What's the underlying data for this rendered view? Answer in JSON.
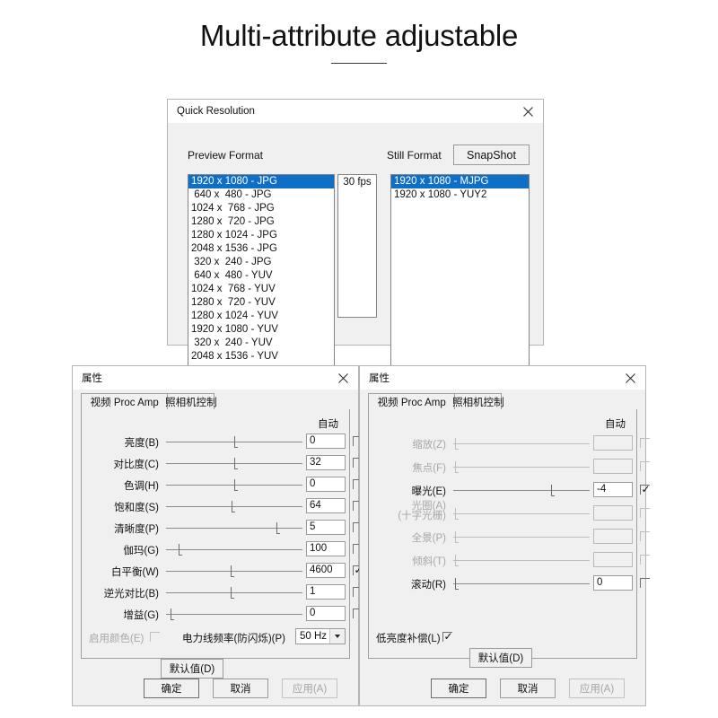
{
  "heading": {
    "title": "Multi-attribute adjustable"
  },
  "quick_resolution": {
    "window_title": "Quick Resolution",
    "close_icon": "close-icon",
    "preview_format_label": "Preview Format",
    "still_format_label": "Still Format",
    "snapshot_button": "SnapShot",
    "fps_items": [
      "30 fps"
    ],
    "preview_formats": [
      "1920 x 1080 - JPG",
      " 640 x  480 - JPG",
      "1024 x  768 - JPG",
      "1280 x  720 - JPG",
      "1280 x 1024 - JPG",
      "2048 x 1536 - JPG",
      " 320 x  240 - JPG",
      " 640 x  480 - YUV",
      "1024 x  768 - YUV",
      "1280 x  720 - YUV",
      "1280 x 1024 - YUV",
      "1920 x 1080 - YUV",
      " 320 x  240 - YUV",
      "2048 x 1536 - YUV"
    ],
    "preview_selected_index": 0,
    "still_formats": [
      "1920 x 1080 - MJPG",
      "1920 x 1080 - YUY2"
    ],
    "still_selected_index": 0,
    "selection_color": "#0f6fc6"
  },
  "props_left": {
    "window_title": "属性",
    "close_icon": "close-icon",
    "tabs": [
      {
        "label": "视频 Proc Amp",
        "active": true
      },
      {
        "label": "照相机控制",
        "active": false
      }
    ],
    "auto_header": "自动",
    "rows": [
      {
        "label": "亮度(B)",
        "value": "0",
        "auto": false,
        "thumb": 0.5,
        "enabled": true
      },
      {
        "label": "对比度(C)",
        "value": "32",
        "auto": false,
        "thumb": 0.5,
        "enabled": true
      },
      {
        "label": "色调(H)",
        "value": "0",
        "auto": false,
        "thumb": 0.5,
        "enabled": true
      },
      {
        "label": "饱和度(S)",
        "value": "64",
        "auto": false,
        "thumb": 0.48,
        "enabled": true
      },
      {
        "label": "清晰度(P)",
        "value": "5",
        "auto": false,
        "thumb": 0.82,
        "enabled": true
      },
      {
        "label": "伽玛(G)",
        "value": "100",
        "auto": false,
        "thumb": 0.08,
        "enabled": true
      },
      {
        "label": "白平衡(W)",
        "value": "4600",
        "auto": true,
        "thumb": 0.47,
        "enabled": true
      },
      {
        "label": "逆光对比(B)",
        "value": "1",
        "auto": false,
        "thumb": 0.47,
        "enabled": true
      },
      {
        "label": "增益(G)",
        "value": "0",
        "auto": false,
        "thumb": 0.02,
        "enabled": true
      }
    ],
    "color_enable_label": "启用颜色(E)",
    "color_enable_checked": false,
    "powerline_label": "电力线频率(防闪烁)(P)",
    "powerline_value": "50 Hz",
    "default_button": "默认值(D)",
    "ok_button": "确定",
    "cancel_button": "取消",
    "apply_button": "应用(A)"
  },
  "props_right": {
    "window_title": "属性",
    "close_icon": "close-icon",
    "tabs": [
      {
        "label": "视频 Proc Amp",
        "active": false
      },
      {
        "label": "照相机控制",
        "active": true
      }
    ],
    "auto_header": "自动",
    "rows": [
      {
        "label": "缩放(Z)",
        "label2": "",
        "value": "",
        "auto": false,
        "thumb": 0.0,
        "enabled": false
      },
      {
        "label": "焦点(F)",
        "label2": "",
        "value": "",
        "auto": false,
        "thumb": 0.0,
        "enabled": false
      },
      {
        "label": "曝光(E)",
        "label2": "",
        "value": "-4",
        "auto": true,
        "thumb": 0.72,
        "enabled": true
      },
      {
        "label": "光圈(A)",
        "label2": "(十字光栅)",
        "value": "",
        "auto": false,
        "thumb": 0.0,
        "enabled": false
      },
      {
        "label": "全景(P)",
        "label2": "",
        "value": "",
        "auto": false,
        "thumb": 0.0,
        "enabled": false
      },
      {
        "label": "倾斜(T)",
        "label2": "",
        "value": "",
        "auto": false,
        "thumb": 0.0,
        "enabled": false
      },
      {
        "label": "滚动(R)",
        "label2": "",
        "value": "0",
        "auto": false,
        "thumb": 0.0,
        "enabled": true
      }
    ],
    "lowlight_label": "低亮度补偿(L)",
    "lowlight_checked": true,
    "default_button": "默认值(D)",
    "ok_button": "确定",
    "cancel_button": "取消",
    "apply_button": "应用(A)"
  }
}
